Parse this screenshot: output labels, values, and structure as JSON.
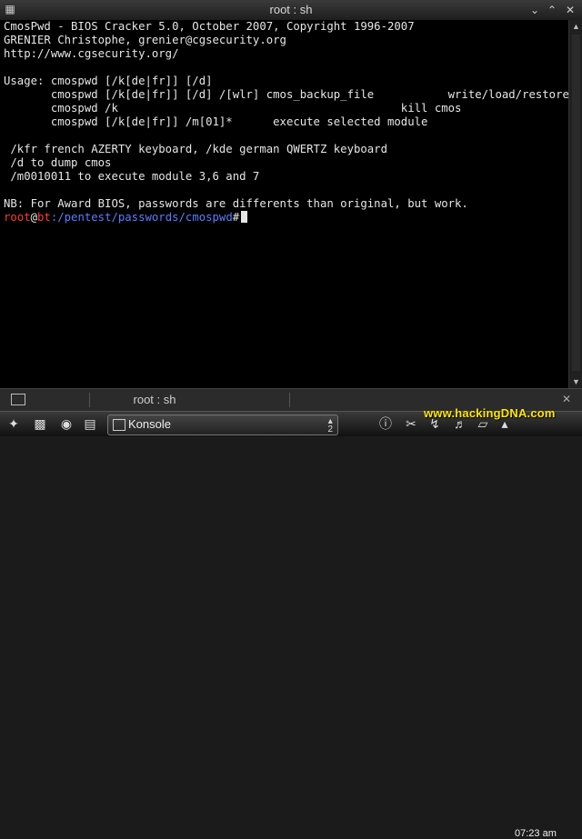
{
  "window": {
    "title": "root : sh"
  },
  "terminal": {
    "lines": [
      "CmosPwd - BIOS Cracker 5.0, October 2007, Copyright 1996-2007",
      "GRENIER Christophe, grenier@cgsecurity.org",
      "http://www.cgsecurity.org/",
      "",
      "Usage: cmospwd [/k[de|fr]] [/d]",
      "       cmospwd [/k[de|fr]] [/d] /[wlr] cmos_backup_file           write/load/restore",
      "       cmospwd /k                                          kill cmos",
      "       cmospwd [/k[de|fr]] /m[01]*      execute selected module",
      "",
      " /kfr french AZERTY keyboard, /kde german QWERTZ keyboard",
      " /d to dump cmos",
      " /m0010011 to execute module 3,6 and 7",
      "",
      "NB: For Award BIOS, passwords are differents than original, but work."
    ],
    "prompt": {
      "user": "root",
      "at": "@",
      "host": "bt",
      "path": ":/pentest/passwords/cmospwd",
      "symbol": "#"
    }
  },
  "tabbar": {
    "tab_label": "root : sh"
  },
  "taskbar": {
    "task_label": "Konsole",
    "task_count": "2",
    "watermark": "www.hackingDNA.com",
    "clock": "07:23 am"
  }
}
